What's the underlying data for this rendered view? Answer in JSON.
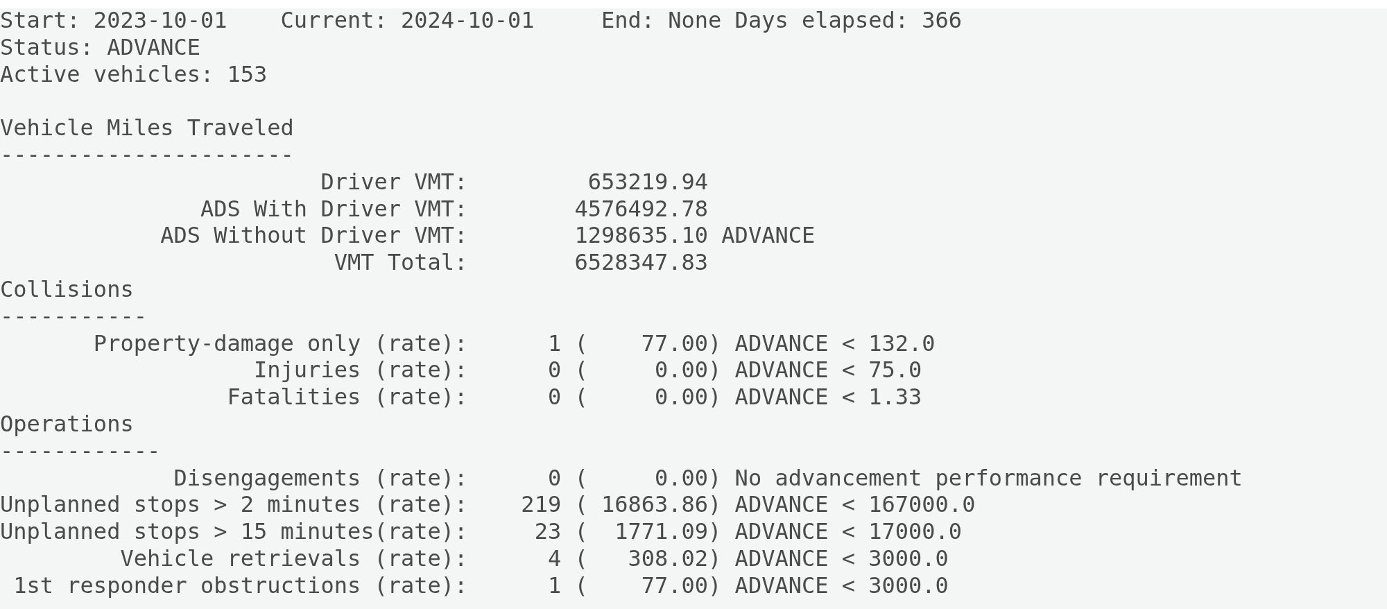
{
  "header": [
    "Start: 2023-10-01    Current: 2024-10-01     End: None Days elapsed: 366",
    "Status: ADVANCE",
    "Active vehicles: 153"
  ],
  "sections": [
    {
      "kind": "vmt",
      "title": "Vehicle Miles Traveled",
      "rule": "----------------------",
      "rows": [
        {
          "label": "Driver VMT:",
          "value": "653219.94"
        },
        {
          "label": "ADS With Driver VMT:",
          "value": "4576492.78"
        },
        {
          "label": "ADS Without Driver VMT:",
          "value": "1298635.10",
          "status": "ADVANCE"
        },
        {
          "label": "VMT Total:",
          "value": "6528347.83"
        }
      ]
    },
    {
      "kind": "rate",
      "title": "Collisions",
      "rule": "-----------",
      "rows": [
        {
          "label": "Property-damage only (rate):",
          "count": "1",
          "rate": "(    77.00)",
          "status": "ADVANCE < 132.0"
        },
        {
          "label": "Injuries (rate):",
          "count": "0",
          "rate": "(     0.00)",
          "status": "ADVANCE < 75.0"
        },
        {
          "label": "Fatalities (rate):",
          "count": "0",
          "rate": "(     0.00)",
          "status": "ADVANCE < 1.33"
        }
      ]
    },
    {
      "kind": "rate",
      "title": "Operations",
      "rule": "------------",
      "rows": [
        {
          "label": "Disengagements (rate):",
          "count": "0",
          "rate": "(     0.00)",
          "status": "No advancement performance requirement"
        },
        {
          "label": "Unplanned stops > 2 minutes (rate):",
          "count": "219",
          "rate": "( 16863.86)",
          "status": "ADVANCE < 167000.0"
        },
        {
          "label": "Unplanned stops > 15 minutes(rate):",
          "count": "23",
          "rate": "(  1771.09)",
          "status": "ADVANCE < 17000.0"
        },
        {
          "label": "Vehicle retrievals (rate):",
          "count": "4",
          "rate": "(   308.02)",
          "status": "ADVANCE < 3000.0"
        },
        {
          "label": "1st responder obstructions (rate):",
          "count": "1",
          "rate": "(    77.00)",
          "status": "ADVANCE < 3000.0"
        }
      ]
    }
  ]
}
